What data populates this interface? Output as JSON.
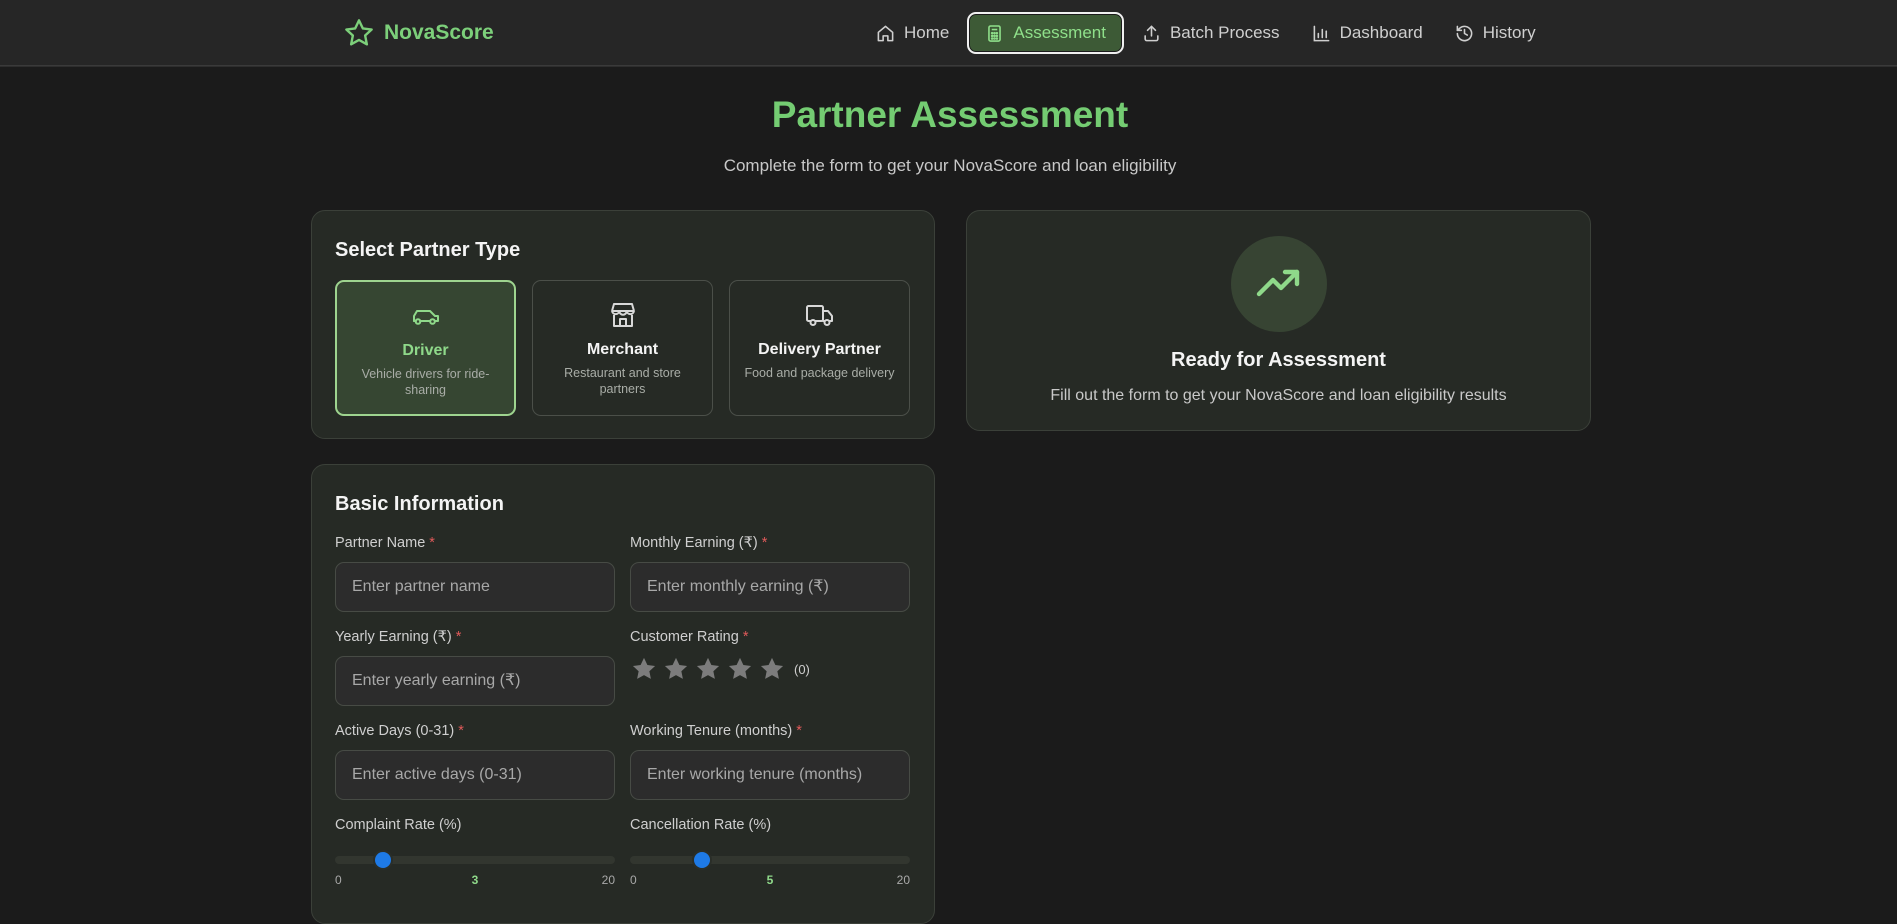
{
  "brand": {
    "name": "NovaScore",
    "icon": "star-icon"
  },
  "nav": {
    "items": [
      {
        "label": "Home",
        "icon": "home-icon"
      },
      {
        "label": "Assessment",
        "icon": "calculator-icon",
        "active": true
      },
      {
        "label": "Batch Process",
        "icon": "upload-icon"
      },
      {
        "label": "Dashboard",
        "icon": "bar-chart-icon"
      },
      {
        "label": "History",
        "icon": "history-icon"
      }
    ]
  },
  "header": {
    "title": "Partner Assessment",
    "subtitle": "Complete the form to get your NovaScore and loan eligibility"
  },
  "partner_type": {
    "title": "Select Partner Type",
    "options": [
      {
        "name": "Driver",
        "desc": "Vehicle drivers for ride-sharing",
        "icon": "car-icon",
        "selected": true
      },
      {
        "name": "Merchant",
        "desc": "Restaurant and store partners",
        "icon": "store-icon"
      },
      {
        "name": "Delivery Partner",
        "desc": "Food and package delivery",
        "icon": "truck-icon"
      }
    ]
  },
  "ready": {
    "icon": "trending-up-icon",
    "title": "Ready for Assessment",
    "subtitle": "Fill out the form to get your NovaScore and loan eligibility results"
  },
  "basic_info": {
    "title": "Basic Information",
    "required_mark": "*",
    "partner_name": {
      "label": "Partner Name",
      "placeholder": "Enter partner name"
    },
    "monthly_earning": {
      "label": "Monthly Earning (₹)",
      "placeholder": "Enter monthly earning (₹)"
    },
    "yearly_earning": {
      "label": "Yearly Earning (₹)",
      "placeholder": "Enter yearly earning (₹)"
    },
    "customer_rating": {
      "label": "Customer Rating",
      "max_stars": 5,
      "value": 0,
      "count_text": "(0)"
    },
    "active_days": {
      "label": "Active Days (0-31)",
      "placeholder": "Enter active days (0-31)"
    },
    "working_tenure": {
      "label": "Working Tenure (months)",
      "placeholder": "Enter working tenure (months)"
    },
    "complaint_rate": {
      "label": "Complaint Rate (%)",
      "min": "0",
      "value": "3",
      "max": "20"
    },
    "cancellation_rate": {
      "label": "Cancellation Rate (%)",
      "min": "0",
      "value": "5",
      "max": "20"
    }
  },
  "colors": {
    "accent": "#74cc72",
    "active_nav_bg": "#3d5a36",
    "slider_thumb": "#1e7ae6",
    "required": "#e05a5a"
  }
}
